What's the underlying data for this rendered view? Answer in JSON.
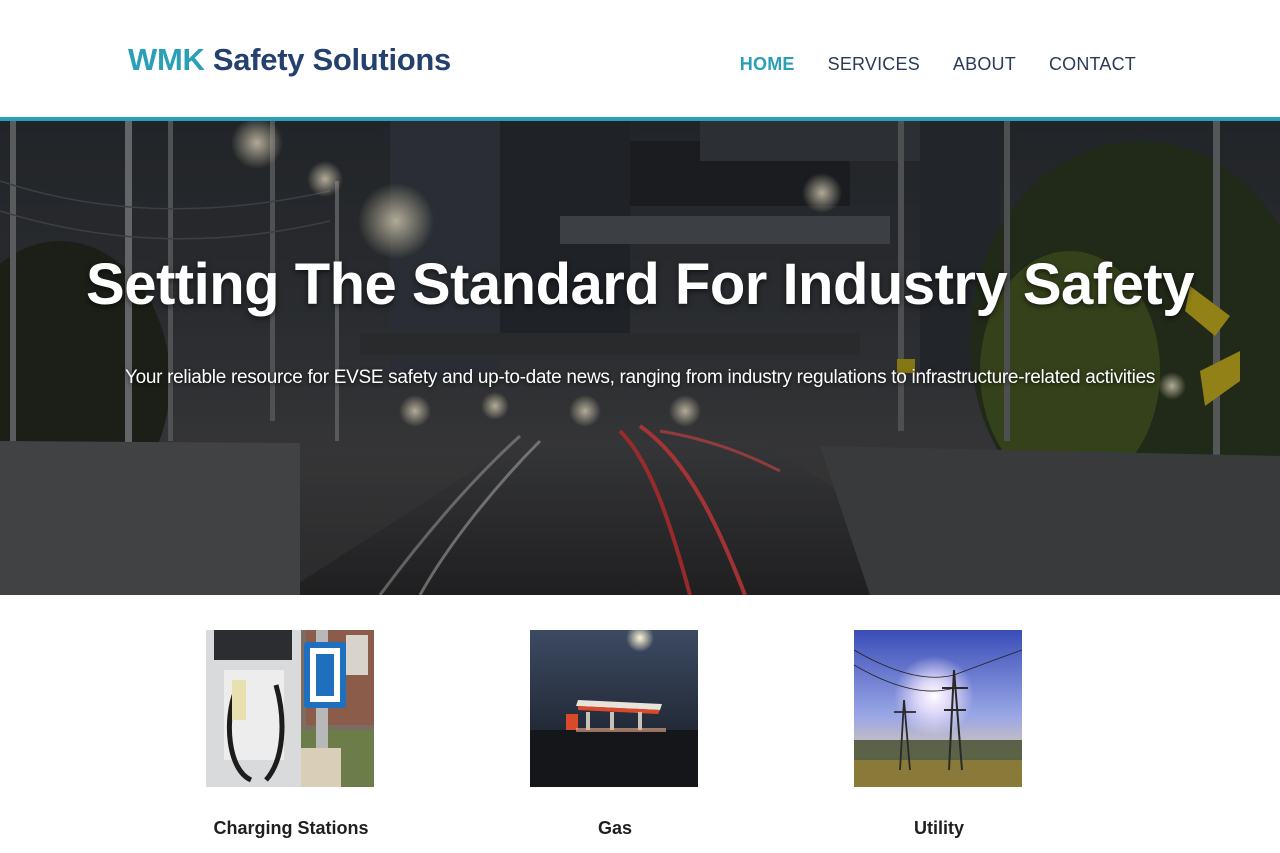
{
  "header": {
    "logo_accent": "WMK",
    "logo_main": "Safety Solutions",
    "nav": [
      {
        "label": "HOME",
        "active": true
      },
      {
        "label": "SERVICES",
        "active": false
      },
      {
        "label": "ABOUT",
        "active": false
      },
      {
        "label": "CONTACT",
        "active": false
      }
    ]
  },
  "hero": {
    "title": "Setting The Standard For Industry Safety",
    "subtitle": "Your reliable resource for EVSE safety and up-to-date news, ranging from industry regulations to infrastructure-related activities"
  },
  "cards": [
    {
      "caption": "Charging Stations"
    },
    {
      "caption": "Gas"
    },
    {
      "caption": "Utility"
    }
  ],
  "colors": {
    "accent": "#2a9fb6",
    "brand_dark": "#24406f",
    "nav_text": "#2b3a57"
  }
}
